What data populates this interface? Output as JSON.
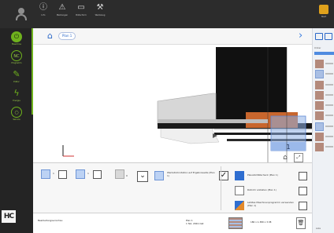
{
  "topbar": {
    "buttons": [
      {
        "icon": "info-icon",
        "glyph": "ⓘ",
        "label": "Info"
      },
      {
        "icon": "warning-icon",
        "glyph": "⚠",
        "label": "Meldungen"
      },
      {
        "icon": "screen-icon",
        "glyph": "▭",
        "label": "Bildschirm"
      },
      {
        "icon": "wrench-icon",
        "glyph": "⚒",
        "label": "Werkzeug"
      }
    ],
    "right_label": "Start"
  },
  "sidebar": {
    "items": [
      {
        "icon": "power-icon",
        "glyph": "⏻",
        "label": "Maschine"
      },
      {
        "icon": "nc-icon",
        "glyph": "NC",
        "label": "Programm"
      },
      {
        "icon": "pencil-icon",
        "glyph": "✎",
        "label": "Editor"
      },
      {
        "icon": "lightning-icon",
        "glyph": "ϟ",
        "label": "Energie"
      },
      {
        "icon": "circle-icon",
        "glyph": "○",
        "label": "Service"
      }
    ],
    "brand": "HC"
  },
  "breadcrumb": {
    "home_icon": "home-icon",
    "item": "Plan 1"
  },
  "viewport": {
    "view_badge": "1"
  },
  "settings": {
    "left_small_1": "1",
    "left_small_2": "1",
    "left_mini": "0",
    "option_text": "Werkstückrotation auf Ergebnisseite (Plan 1)",
    "option_checked": true,
    "rows": [
      {
        "text": "Plausibilitätscheck (Plan 1)"
      },
      {
        "text": "Rollrohr erstellen (Plan 1)"
      },
      {
        "text": "Letztes Maschinenprogramm verwenden (Plan 1)"
      }
    ]
  },
  "status": {
    "col1": "Bearbeitungsvorschau",
    "col2": "Plan 1\n1 Teil, 2024.mat",
    "col3": "180 x 1.380 x 3.38",
    "trash_icon": "trash-icon"
  },
  "right_panel": {
    "header": "Ordner",
    "rows": 9,
    "footer": "Liste"
  }
}
